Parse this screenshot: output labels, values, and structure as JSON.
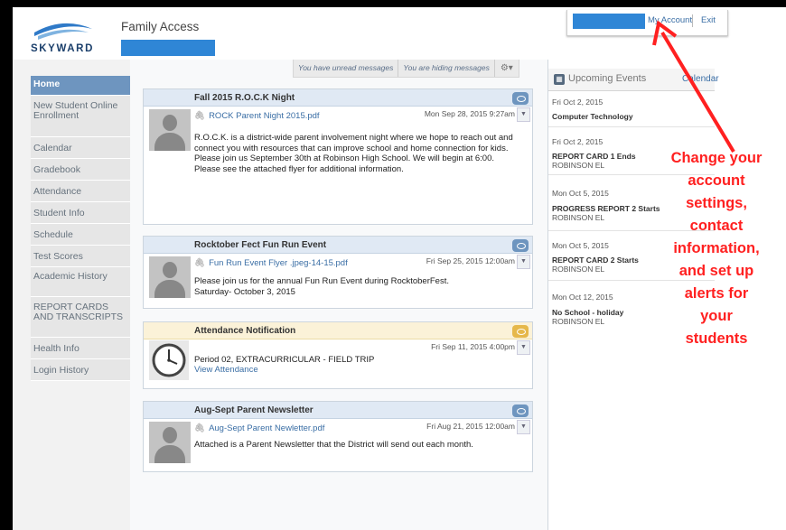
{
  "header": {
    "logo_text": "SKYWARD",
    "app_title": "Family Access",
    "my_account": "My Account",
    "exit": "Exit"
  },
  "sidebar": {
    "items": [
      {
        "label": "Home"
      },
      {
        "label": "New Student Online Enrollment"
      },
      {
        "label": "Calendar"
      },
      {
        "label": "Gradebook"
      },
      {
        "label": "Attendance"
      },
      {
        "label": "Student Info"
      },
      {
        "label": "Schedule"
      },
      {
        "label": "Test Scores"
      },
      {
        "label": "Academic History"
      },
      {
        "label": "REPORT CARDS AND TRANSCRIPTS"
      },
      {
        "label": "Health Info"
      },
      {
        "label": "Login History"
      }
    ]
  },
  "message_bar": {
    "unread": "You have unread messages",
    "hiding": "You are hiding messages",
    "settings_icon": "gear-icon"
  },
  "cards": [
    {
      "title": "Fall 2015 R.O.C.K Night",
      "attachment": "ROCK Parent Night 2015.pdf",
      "date": "Mon Sep 28, 2015 9:27am",
      "body": "R.O.C.K. is a district-wide parent involvement night where we hope to reach out and connect you with resources that can improve school and home connection for kids. Please join us September 30th at Robinson High School. We will begin at 6:00. Please see the attached flyer for additional information."
    },
    {
      "title": "Rocktober Fect Fun Run Event",
      "attachment": "Fun Run Event Flyer .jpeg-14-15.pdf",
      "date": "Fri Sep 25, 2015 12:00am",
      "body": "Please join us for the annual Fun Run Event during RocktoberFest. Saturday- October 3, 2015"
    },
    {
      "title": "Attendance Notification",
      "date": "Fri Sep 11, 2015 4:00pm",
      "body": "Period 02, EXTRACURRICULAR - FIELD TRIP",
      "link": "View Attendance"
    },
    {
      "title": "Aug-Sept Parent Newsletter",
      "attachment": "Aug-Sept Parent Newletter.pdf",
      "date": "Fri Aug 21, 2015 12:00am",
      "body": "Attached is a Parent Newsletter that the District will send out each month."
    }
  ],
  "events": {
    "title": "Upcoming Events",
    "calendar_link": "Calendar",
    "items": [
      {
        "date": "Fri Oct 2, 2015",
        "name": "Computer Technology",
        "location": ""
      },
      {
        "date": "Fri Oct 2, 2015",
        "name": "REPORT CARD 1 Ends",
        "location": "ROBINSON EL"
      },
      {
        "date": "Mon Oct 5, 2015",
        "name": "PROGRESS REPORT 2 Starts",
        "location": "ROBINSON EL"
      },
      {
        "date": "Mon Oct 5, 2015",
        "name": "REPORT CARD 2 Starts",
        "location": "ROBINSON EL"
      },
      {
        "date": "Mon Oct 12, 2015",
        "name": "No School - holiday",
        "location": "ROBINSON EL"
      }
    ]
  },
  "annotation": {
    "lines": [
      "Change your",
      "account",
      "settings,",
      "contact",
      "information,",
      "and set up",
      "alerts for",
      "your",
      "students"
    ]
  },
  "colors": {
    "accent": "#6e95bf",
    "link": "#3a6ea5",
    "annotation": "#ff2020",
    "redacted": "#2f86d6"
  }
}
